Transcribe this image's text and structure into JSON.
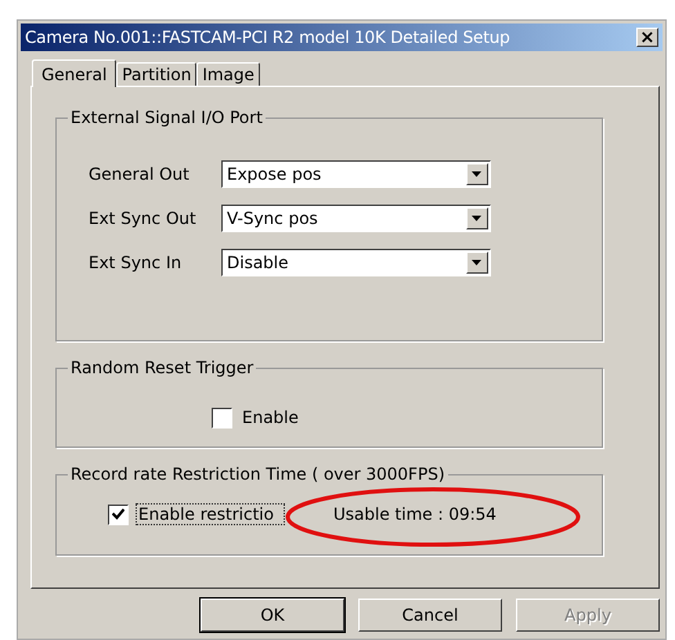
{
  "window": {
    "title": "Camera No.001::FASTCAM-PCI R2 model 10K Detailed Setup",
    "close": "×"
  },
  "tabs": [
    {
      "label": "General",
      "selected": true
    },
    {
      "label": "Partition",
      "selected": false
    },
    {
      "label": "Image",
      "selected": false
    }
  ],
  "io_group": {
    "title": "External Signal I/O Port",
    "rows": [
      {
        "label": "General Out",
        "value": "Expose pos"
      },
      {
        "label": "Ext Sync Out",
        "value": "V-Sync pos"
      },
      {
        "label": "Ext Sync In",
        "value": "Disable"
      }
    ]
  },
  "reset_group": {
    "title": "Random Reset Trigger",
    "checkbox": {
      "label": "Enable",
      "checked": false
    }
  },
  "restriction_group": {
    "title": "Record rate Restriction Time ( over 3000FPS)",
    "checkbox": {
      "label": "Enable restrictio",
      "checked": true,
      "focused": true
    },
    "usable_time": "Usable time  :  09:54"
  },
  "buttons": [
    {
      "label": "OK",
      "disabled": false,
      "default": true
    },
    {
      "label": "Cancel",
      "disabled": false,
      "default": false
    },
    {
      "label": "Apply",
      "disabled": true,
      "default": false
    }
  ]
}
